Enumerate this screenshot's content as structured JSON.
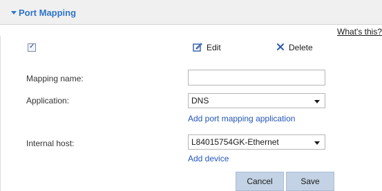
{
  "section": {
    "title": "Port Mapping",
    "help_link": "What's this?"
  },
  "toolbar": {
    "select_all_checked": true,
    "select_all_mark": "✓",
    "edit_label": "Edit",
    "edit_icon": "pencil-square-icon",
    "delete_label": "Delete",
    "delete_icon": "x-icon"
  },
  "form": {
    "mapping_name": {
      "label": "Mapping name:",
      "value": ""
    },
    "application": {
      "label": "Application:",
      "selected": "DNS",
      "add_link": "Add port mapping application"
    },
    "internal_host": {
      "label": "Internal host:",
      "selected": "L84015754GK-Ethernet",
      "add_link": "Add device"
    }
  },
  "actions": {
    "cancel_label": "Cancel",
    "save_label": "Save"
  },
  "colors": {
    "accent": "#2e74c9",
    "link": "#2456b8",
    "button_bg": "#c3d2e4"
  }
}
